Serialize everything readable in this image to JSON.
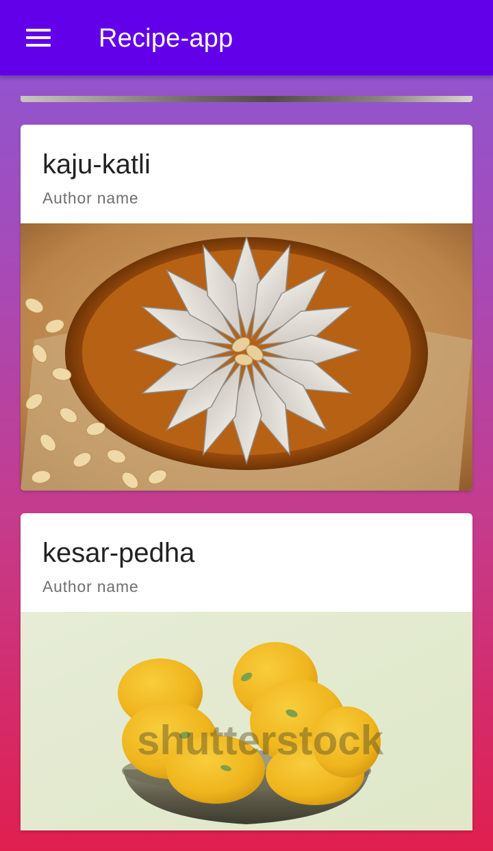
{
  "app_bar": {
    "title": "Recipe-app",
    "menu_icon": "hamburger-menu-icon",
    "background": "#6200ea"
  },
  "recipes": [
    {
      "name": "kaju-katli",
      "author": "Author name",
      "image": "kaju-katli-photo"
    },
    {
      "name": "kesar-pedha",
      "author": "Author name",
      "image": "kesar-pedha-photo",
      "watermark": "shutterstock"
    }
  ],
  "colors": {
    "gradient_top": "#8a58d6",
    "gradient_bottom": "#e01f4f",
    "card_bg": "#ffffff"
  }
}
